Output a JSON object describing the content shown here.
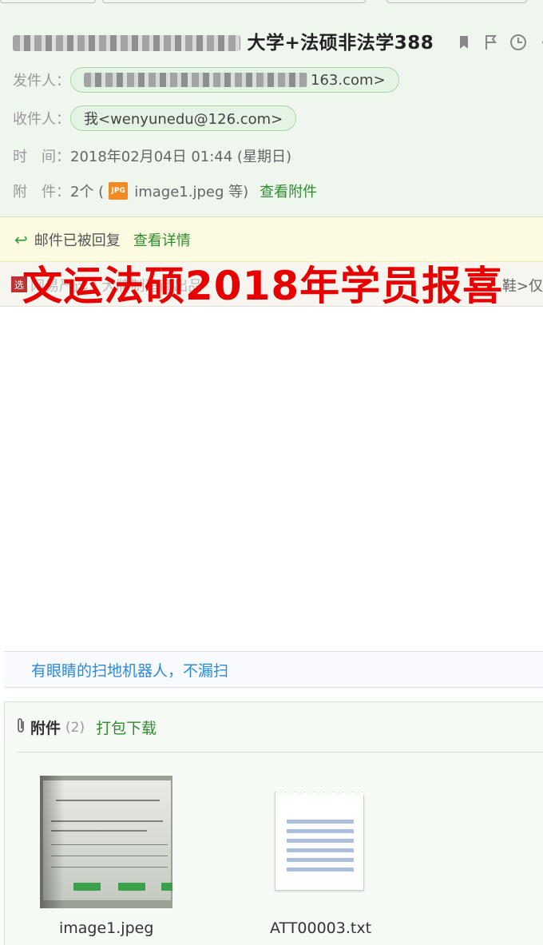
{
  "email": {
    "subject_visible": "大学+法硕非法学388",
    "sender_label": "发件人：",
    "sender_visible": "163.com>",
    "recipient_label": "收件人：",
    "recipient": "我<wenyunedu@126.com>",
    "time_label": "时　间：",
    "time_value": "2018年02月04日 01:44 (星期日)",
    "attach_label": "附　件：",
    "attach_summary_prefix": "2个 (",
    "attach_badge": "JPG",
    "attach_summary_file": "image1.jpeg 等)",
    "view_attachments": "查看附件"
  },
  "notice": {
    "text": "邮件已被回复",
    "link": "查看详情"
  },
  "ad": {
    "badge": "选",
    "text": "网易严选 | 大牌制造商出品",
    "tail": "鞋>仅"
  },
  "overlay_title": "文运法硕2018年学员报喜",
  "promo_link": "有眼睛的扫地机器人，不漏扫",
  "attachments_panel": {
    "title": "附件",
    "count": "(2)",
    "download_all": "打包下载",
    "files": [
      {
        "name": "image1.jpeg",
        "type": "image"
      },
      {
        "name": "ATT00003.txt",
        "type": "text"
      }
    ]
  },
  "colors": {
    "header_bg": "#eef6ee",
    "accent_green": "#2e8b2e",
    "overlay_red": "#e60000",
    "promo_blue": "#2c8ad8"
  }
}
